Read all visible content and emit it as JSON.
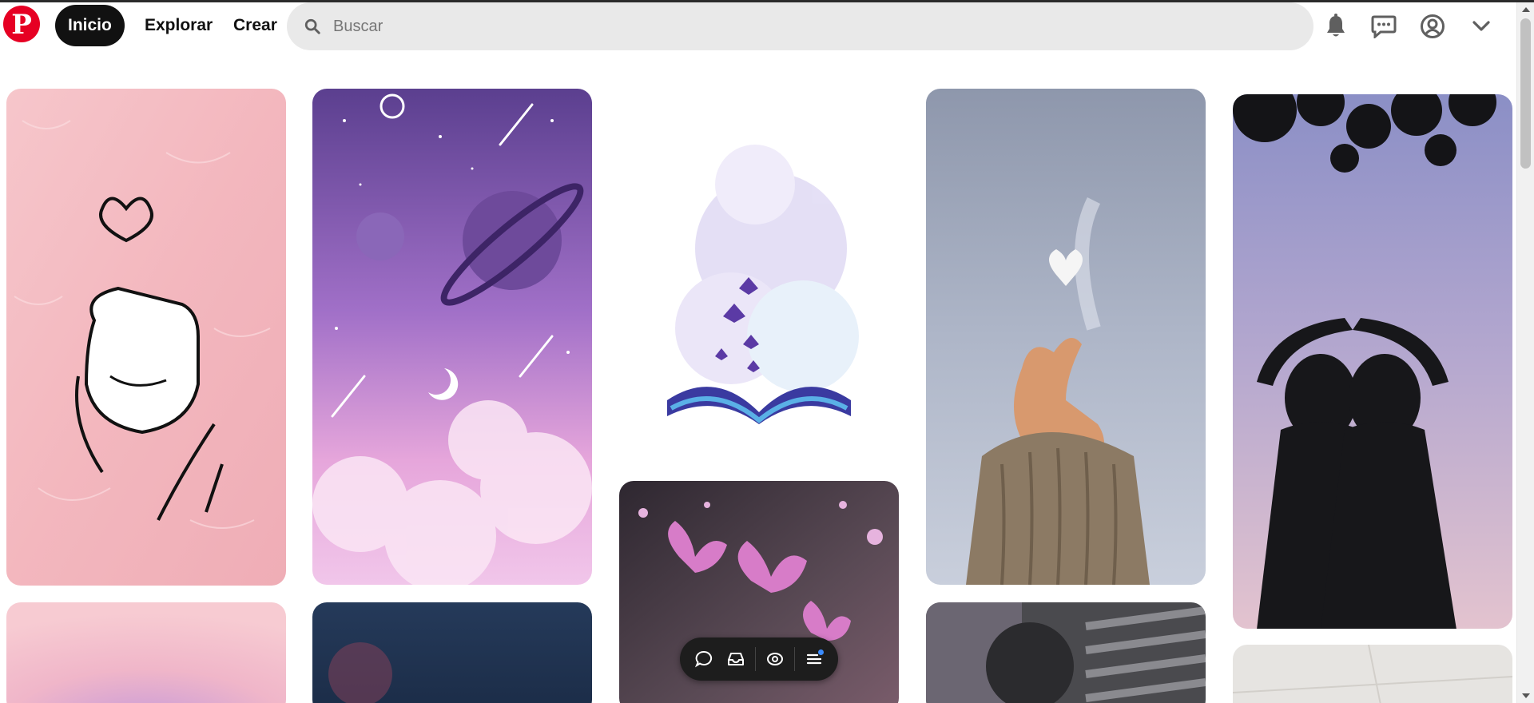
{
  "header": {
    "logo_letter": "P",
    "nav": {
      "home": "Inicio",
      "explore": "Explorar",
      "create": "Crear"
    },
    "search": {
      "placeholder": "Buscar"
    },
    "icons": [
      "bell-icon",
      "message-icon",
      "user-icon",
      "chevron-down-icon"
    ]
  },
  "pins": [
    {
      "id": "pin-pink-fur-hand",
      "subject": "finger heart drawing on pink fur"
    },
    {
      "id": "pin-purple-space",
      "subject": "purple space with planets and moon"
    },
    {
      "id": "pin-butterfly-book",
      "subject": "watercolor book with butterflies"
    },
    {
      "id": "pin-finger-heart-sky",
      "subject": "finger heart under sky"
    },
    {
      "id": "pin-friends-silhouette",
      "subject": "two friends silhouette making heart"
    },
    {
      "id": "pin-pink-gradient"
    },
    {
      "id": "pin-night-sky"
    },
    {
      "id": "pin-pink-butterflies"
    },
    {
      "id": "pin-car-glitter"
    },
    {
      "id": "pin-floor-tiles"
    }
  ],
  "floating_toolbar": {
    "icons": [
      "comment-icon",
      "inbox-icon",
      "eye-icon",
      "menu-icon"
    ],
    "accent_color": "#3b8cff"
  },
  "colors": {
    "brand": "#e60023",
    "home_pill": "#111111",
    "search_bg": "#e9e9e9"
  }
}
